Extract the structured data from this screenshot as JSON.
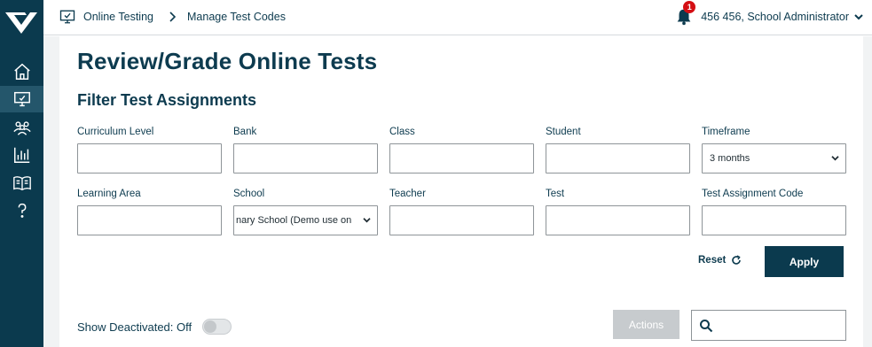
{
  "breadcrumb": {
    "item1": "Online Testing",
    "item2": "Manage Test Codes"
  },
  "header": {
    "notification_count": "1",
    "user_name": "456 456, School Administrator"
  },
  "page": {
    "title": "Review/Grade Online Tests",
    "section_title": "Filter Test Assignments"
  },
  "filters": {
    "curriculum_level": {
      "label": "Curriculum Level",
      "value": ""
    },
    "bank": {
      "label": "Bank",
      "value": ""
    },
    "class": {
      "label": "Class",
      "value": ""
    },
    "student": {
      "label": "Student",
      "value": ""
    },
    "timeframe": {
      "label": "Timeframe",
      "value": "3 months"
    },
    "learning_area": {
      "label": "Learning Area",
      "value": ""
    },
    "school": {
      "label": "School",
      "value": "nary School (Demo use on"
    },
    "teacher": {
      "label": "Teacher",
      "value": ""
    },
    "test": {
      "label": "Test",
      "value": ""
    },
    "test_assignment_code": {
      "label": "Test Assignment Code",
      "value": ""
    }
  },
  "buttons": {
    "reset": "Reset",
    "apply": "Apply",
    "actions": "Actions"
  },
  "show_deactivated": {
    "label": "Show Deactivated:",
    "state": "Off"
  },
  "icons": {
    "logo": "logo-icon",
    "home": "home-icon",
    "monitor": "monitor-icon",
    "users": "users-icon",
    "chart": "bar-chart-icon",
    "book": "book-icon",
    "help": "question-icon",
    "bell": "bell-icon",
    "search": "search-icon",
    "refresh": "refresh-icon"
  },
  "colors": {
    "sidebar": "#0b3a4e",
    "accent": "#0b3a4e",
    "badge": "#d40f14",
    "text": "#0d3b4f"
  }
}
